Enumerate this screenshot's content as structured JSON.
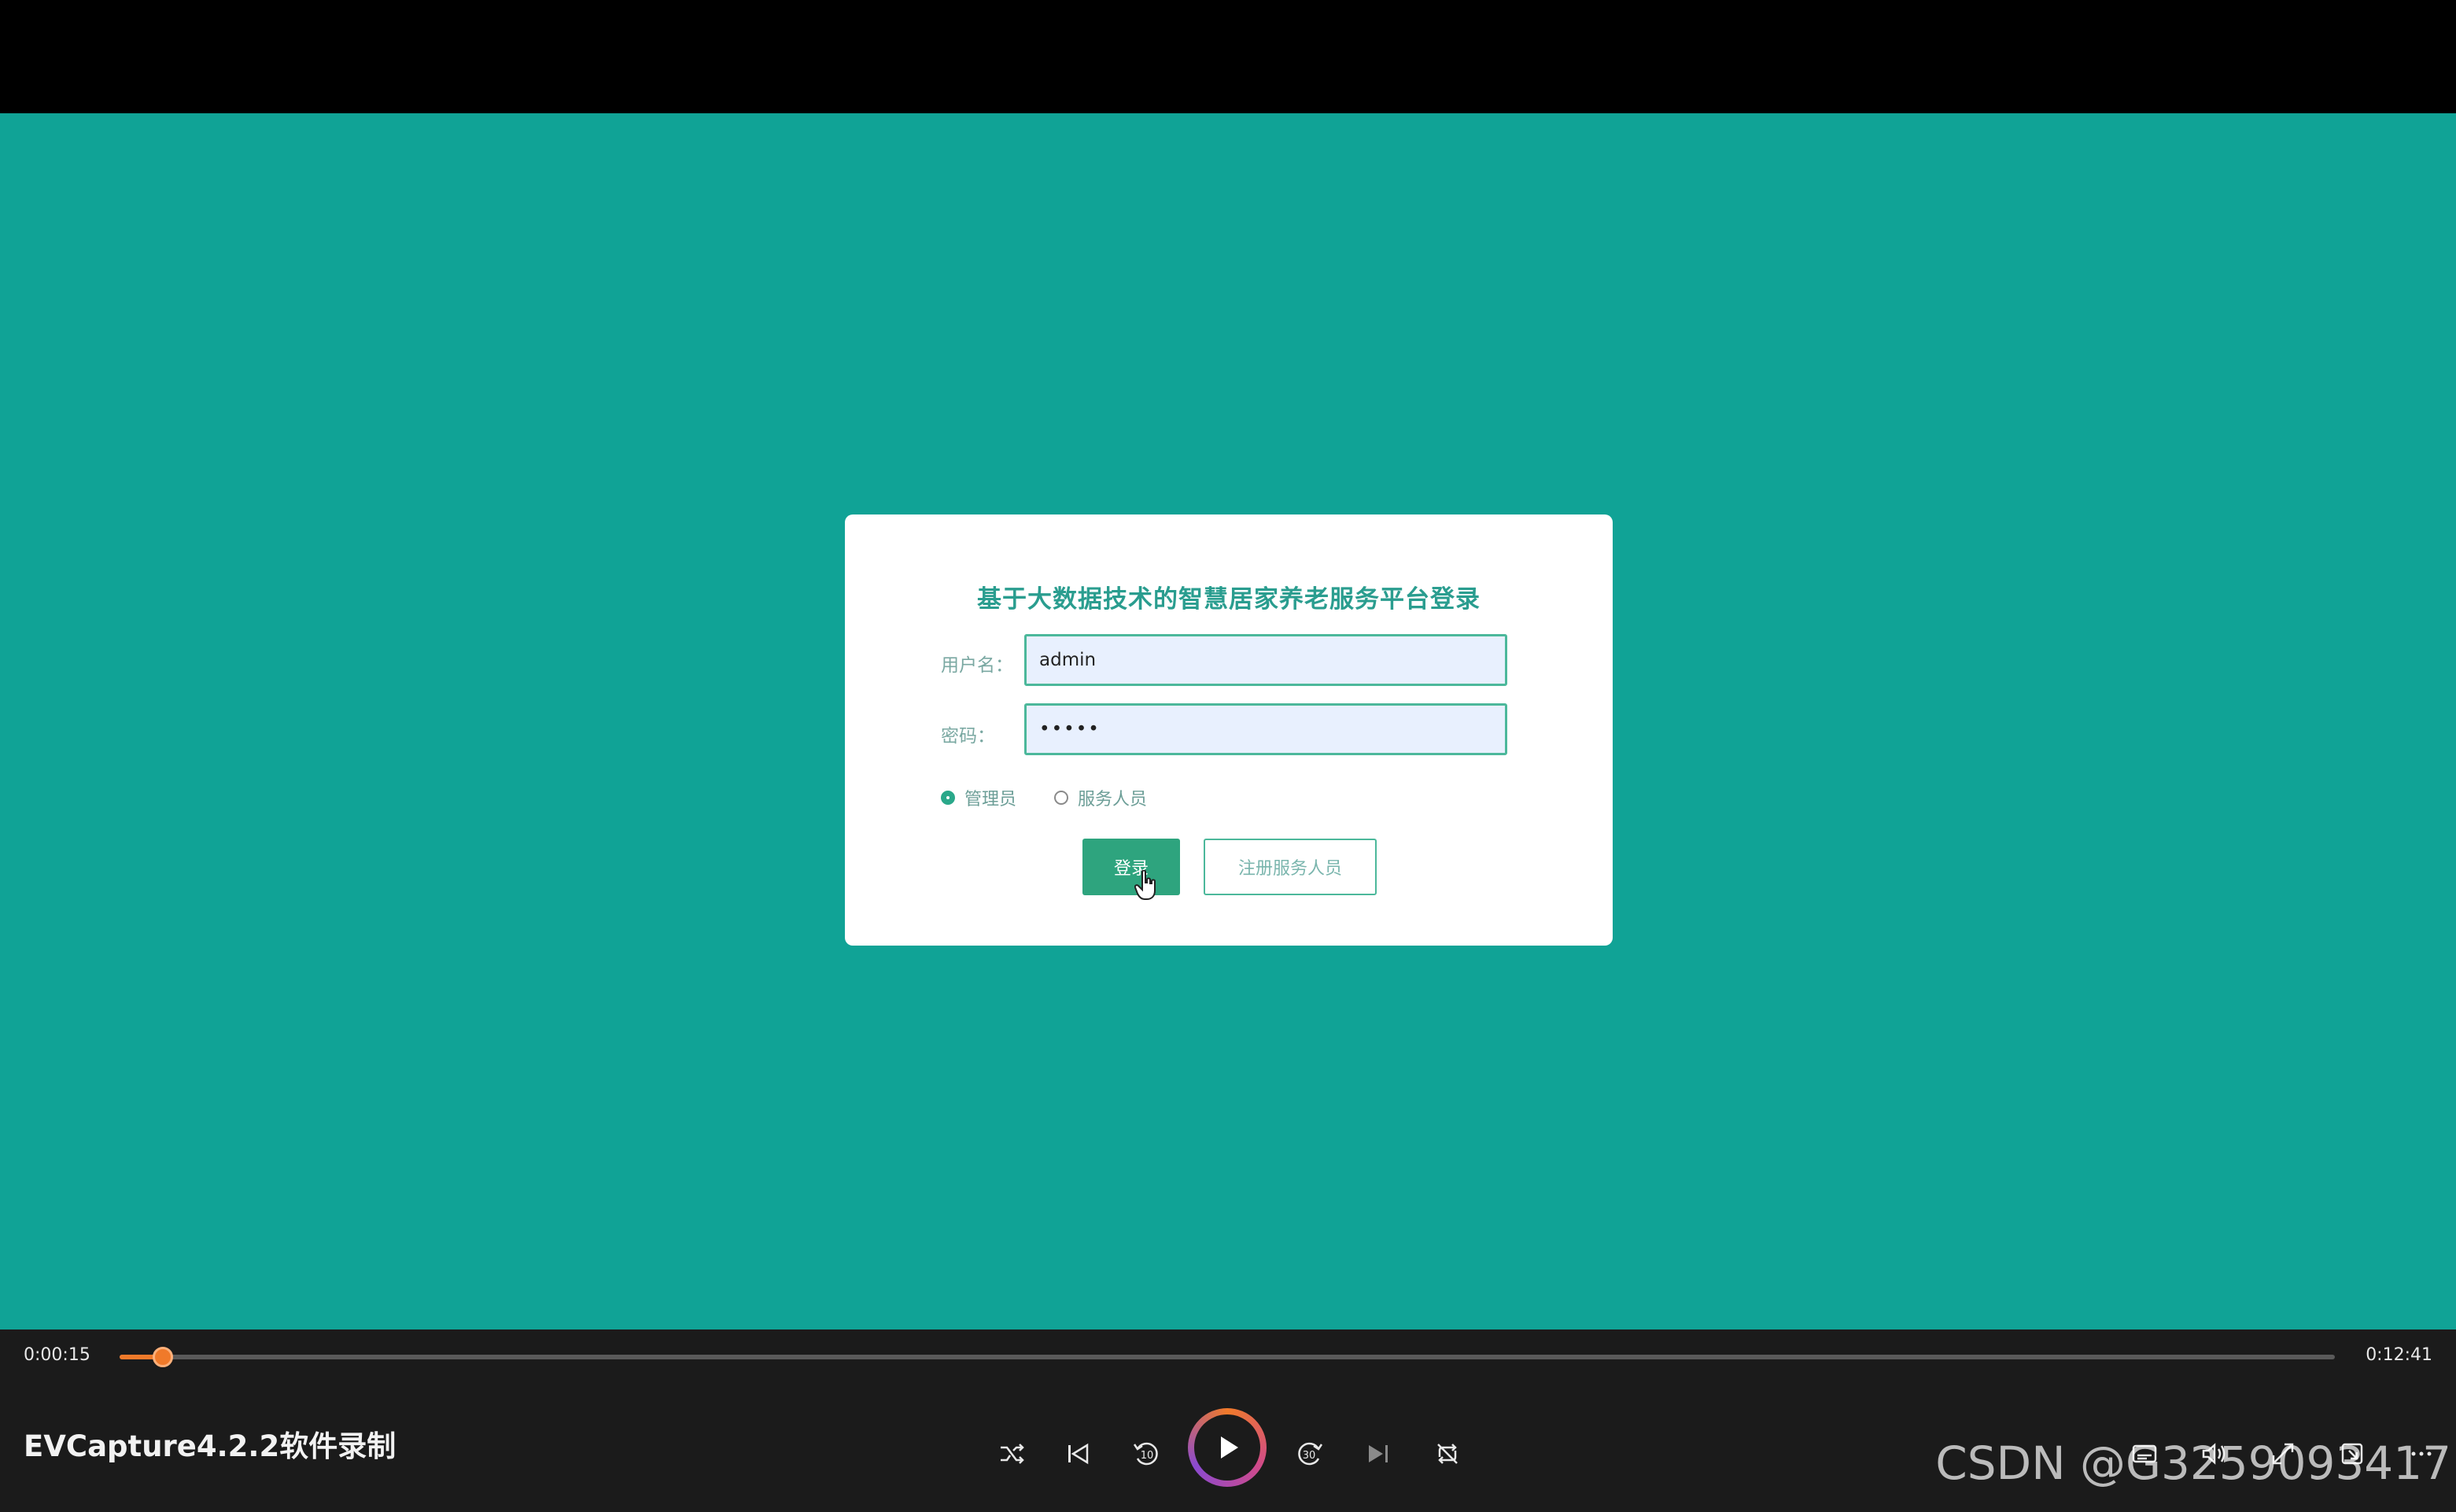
{
  "login": {
    "title": "基于大数据技术的智慧居家养老服务平台登录",
    "username_label": "用户名：",
    "username_value": "admin",
    "password_label": "密码：",
    "password_value": "•••••",
    "role_admin": "管理员",
    "role_staff": "服务人员",
    "login_button": "登录",
    "register_button": "注册服务人员",
    "selected_role": "管理员"
  },
  "player": {
    "elapsed": "0:00:15",
    "total": "0:12:41",
    "progress_fraction": 0.0197,
    "title": "EVCapture4.2.2软件录制",
    "controls": [
      "shuffle-icon",
      "previous-icon",
      "rewind-10-icon",
      "play-icon",
      "forward-30-icon",
      "next-icon",
      "repeat-icon",
      "subtitles-icon",
      "volume-icon",
      "fullscreen-icon",
      "mini-player-icon",
      "more-icon"
    ]
  },
  "watermark": "CSDN @G3259093417",
  "colors": {
    "stage": "#10a396",
    "accent": "#2ea47e",
    "seek": "#f07a2a"
  }
}
